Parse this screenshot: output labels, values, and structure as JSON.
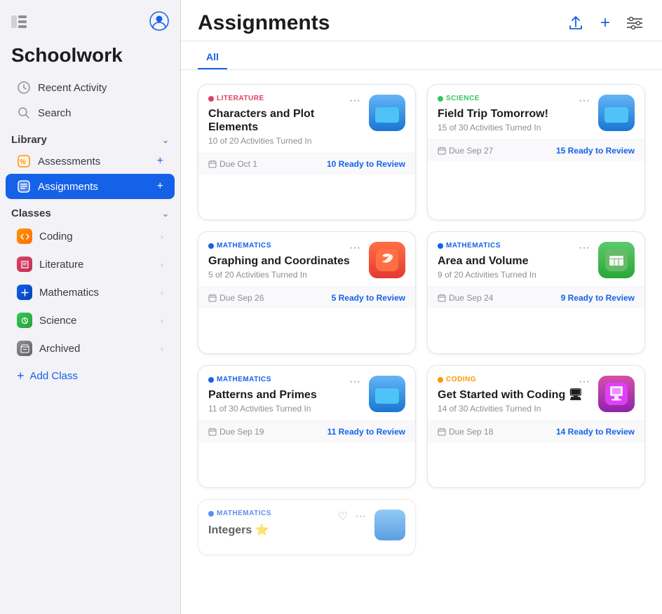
{
  "sidebar": {
    "title": "Schoolwork",
    "top_icons": {
      "sidebar_toggle": "sidebar-toggle-icon",
      "profile": "person-circle-icon"
    },
    "nav_items": [
      {
        "id": "recent-activity",
        "label": "Recent Activity",
        "icon": "clock"
      },
      {
        "id": "search",
        "label": "Search",
        "icon": "magnifier"
      }
    ],
    "library_section": {
      "label": "Library",
      "items": [
        {
          "id": "assessments",
          "label": "Assessments",
          "icon": "percent"
        },
        {
          "id": "assignments",
          "label": "Assignments",
          "icon": "list",
          "active": true
        }
      ]
    },
    "classes_section": {
      "label": "Classes",
      "items": [
        {
          "id": "coding",
          "label": "Coding",
          "color": "coding"
        },
        {
          "id": "literature",
          "label": "Literature",
          "color": "literature"
        },
        {
          "id": "mathematics",
          "label": "Mathematics",
          "color": "math"
        },
        {
          "id": "science",
          "label": "Science",
          "color": "science"
        },
        {
          "id": "archived",
          "label": "Archived",
          "color": "archived"
        }
      ]
    },
    "add_class_label": "Add Class"
  },
  "main": {
    "title": "Assignments",
    "header_actions": {
      "share_label": "↑",
      "add_label": "+",
      "filter_label": "⊟"
    },
    "tabs": [
      {
        "id": "all",
        "label": "All",
        "active": true
      }
    ],
    "cards": [
      {
        "id": "card-1",
        "subject": "LITERATURE",
        "subject_color": "literature",
        "title": "Characters and Plot Elements",
        "activities": "10 of 20 Activities Turned In",
        "due": "Due Oct 1",
        "review": "10 Ready to Review",
        "icon_type": "folder-blue"
      },
      {
        "id": "card-2",
        "subject": "SCIENCE",
        "subject_color": "science",
        "title": "Field Trip Tomorrow!",
        "activities": "15 of 30 Activities Turned In",
        "due": "Due Sep 27",
        "review": "15 Ready to Review",
        "icon_type": "folder-blue"
      },
      {
        "id": "card-3",
        "subject": "MATHEMATICS",
        "subject_color": "mathematics",
        "title": "Graphing and Coordinates",
        "activities": "5 of 20 Activities Turned In",
        "due": "Due Sep 26",
        "review": "5 Ready to Review",
        "icon_type": "swift"
      },
      {
        "id": "card-4",
        "subject": "MATHEMATICS",
        "subject_color": "mathematics",
        "title": "Area and Volume",
        "activities": "9 of 20 Activities Turned In",
        "due": "Due Sep 24",
        "review": "9 Ready to Review",
        "icon_type": "numbers"
      },
      {
        "id": "card-5",
        "subject": "MATHEMATICS",
        "subject_color": "mathematics",
        "title": "Patterns and Primes",
        "activities": "11 of 30 Activities Turned In",
        "due": "Due Sep 19",
        "review": "11 Ready to Review",
        "icon_type": "folder-blue"
      },
      {
        "id": "card-6",
        "subject": "CODING",
        "subject_color": "coding",
        "title": "Get Started with Coding 🖥",
        "activities": "14 of 30 Activities Turned In",
        "due": "Due Sep 18",
        "review": "14 Ready to Review",
        "icon_type": "keynote"
      },
      {
        "id": "card-7",
        "subject": "MATHEMATICS",
        "subject_color": "mathematics",
        "title": "Integers ⭐",
        "activities": "",
        "due": "",
        "review": "",
        "icon_type": "folder-blue",
        "partial": true
      }
    ]
  }
}
